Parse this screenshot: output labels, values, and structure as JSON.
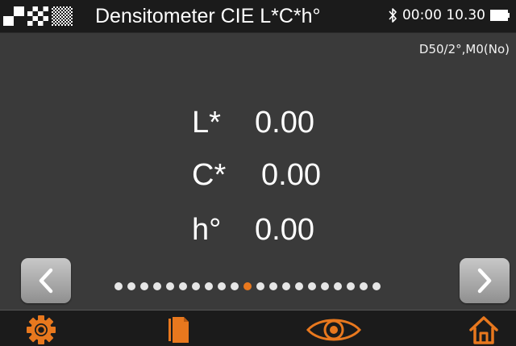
{
  "header": {
    "mode_icons": [
      "solid-patch-icon",
      "checker-patch-icon",
      "fine-checker-patch-icon"
    ],
    "title": "Densitometer CIE L*C*h°",
    "status": {
      "bluetooth_icon": "bluetooth-icon",
      "time": "00:00 10.30",
      "battery_icon": "battery-icon"
    }
  },
  "illuminant": "D50/2°,M0(No)",
  "readings": [
    {
      "label": "L*",
      "value": "0.00"
    },
    {
      "label": "C*",
      "value": "0.00"
    },
    {
      "label": "h°",
      "value": "0.00"
    }
  ],
  "pager": {
    "prev_icon": "chevron-left-icon",
    "next_icon": "chevron-right-icon",
    "total_pages": 21,
    "current_page": 11,
    "active_color": "#e8781e"
  },
  "toolbar": {
    "items": [
      "gear-icon",
      "document-pages-icon",
      "eye-icon",
      "home-icon"
    ]
  },
  "colors": {
    "background": "#3a3a3a",
    "bar": "#1b1b1b",
    "accent": "#e8781e"
  }
}
